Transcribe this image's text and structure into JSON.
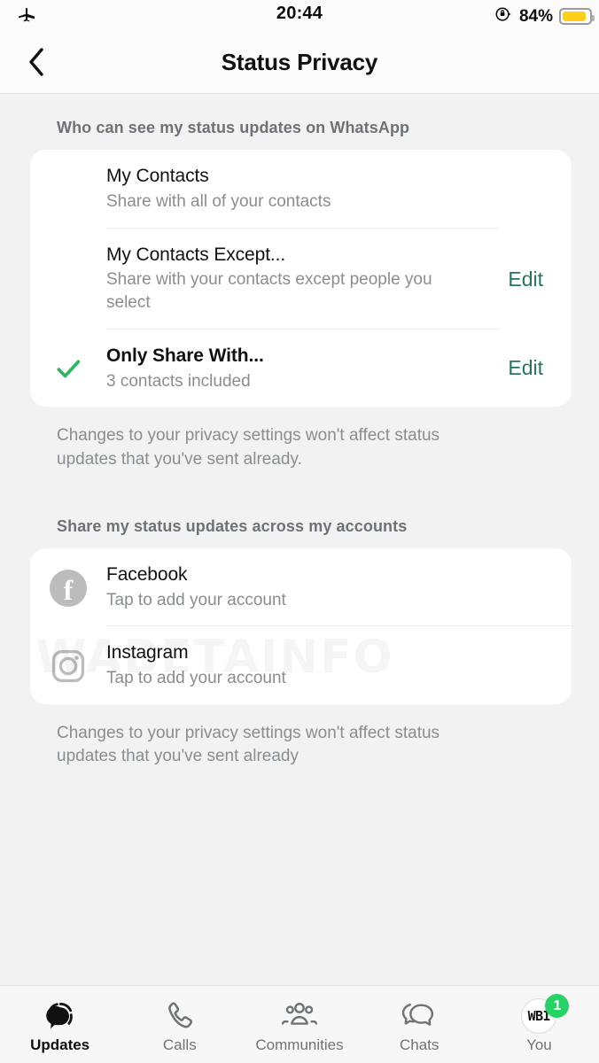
{
  "status_bar": {
    "airplane_icon": "airplane-mode-icon",
    "time": "20:44",
    "rotation_lock_icon": "rotation-lock-icon",
    "battery_percent": "84%",
    "battery_icon": "battery-low-power-icon",
    "battery_color": "#fdd017"
  },
  "nav": {
    "back_icon": "back-chevron-icon",
    "title": "Status Privacy"
  },
  "colors": {
    "page_background": "#f2f2f2",
    "card_background": "#ffffff",
    "accent_green": "#21785c",
    "check_green": "#2bb662",
    "badge_green": "#25d366",
    "secondary_text": "#8a8d90",
    "section_header_text": "#6e7276"
  },
  "section_one": {
    "header": "Who can see my status updates on WhatsApp",
    "footnote": "Changes to your privacy settings won't affect status updates that you've sent already.",
    "options": [
      {
        "title": "My Contacts",
        "subtitle": "Share with all of your contacts",
        "selected": false,
        "action": ""
      },
      {
        "title": "My Contacts Except...",
        "subtitle": "Share with your contacts except people you select",
        "selected": false,
        "action": "Edit"
      },
      {
        "title": "Only Share With...",
        "subtitle": "3 contacts included",
        "selected": true,
        "action": "Edit"
      }
    ]
  },
  "section_two": {
    "header": "Share my status updates across my accounts",
    "footnote": "Changes to your privacy settings won't affect status updates that you've sent already",
    "accounts": [
      {
        "icon": "facebook-icon",
        "title": "Facebook",
        "subtitle": "Tap to add your account"
      },
      {
        "icon": "instagram-icon",
        "title": "Instagram",
        "subtitle": "Tap to add your account"
      }
    ]
  },
  "watermark": {
    "text": "WABETAINFO"
  },
  "tab_bar": {
    "tabs": [
      {
        "icon": "status-updates-icon",
        "label": "Updates",
        "active": true,
        "badge": ""
      },
      {
        "icon": "phone-icon",
        "label": "Calls",
        "active": false,
        "badge": ""
      },
      {
        "icon": "communities-icon",
        "label": "Communities",
        "active": false,
        "badge": ""
      },
      {
        "icon": "chats-bubble-icon",
        "label": "Chats",
        "active": false,
        "badge": ""
      },
      {
        "icon": "avatar-icon",
        "label": "You",
        "active": false,
        "badge": "1",
        "avatar_text": "WBI"
      }
    ]
  }
}
